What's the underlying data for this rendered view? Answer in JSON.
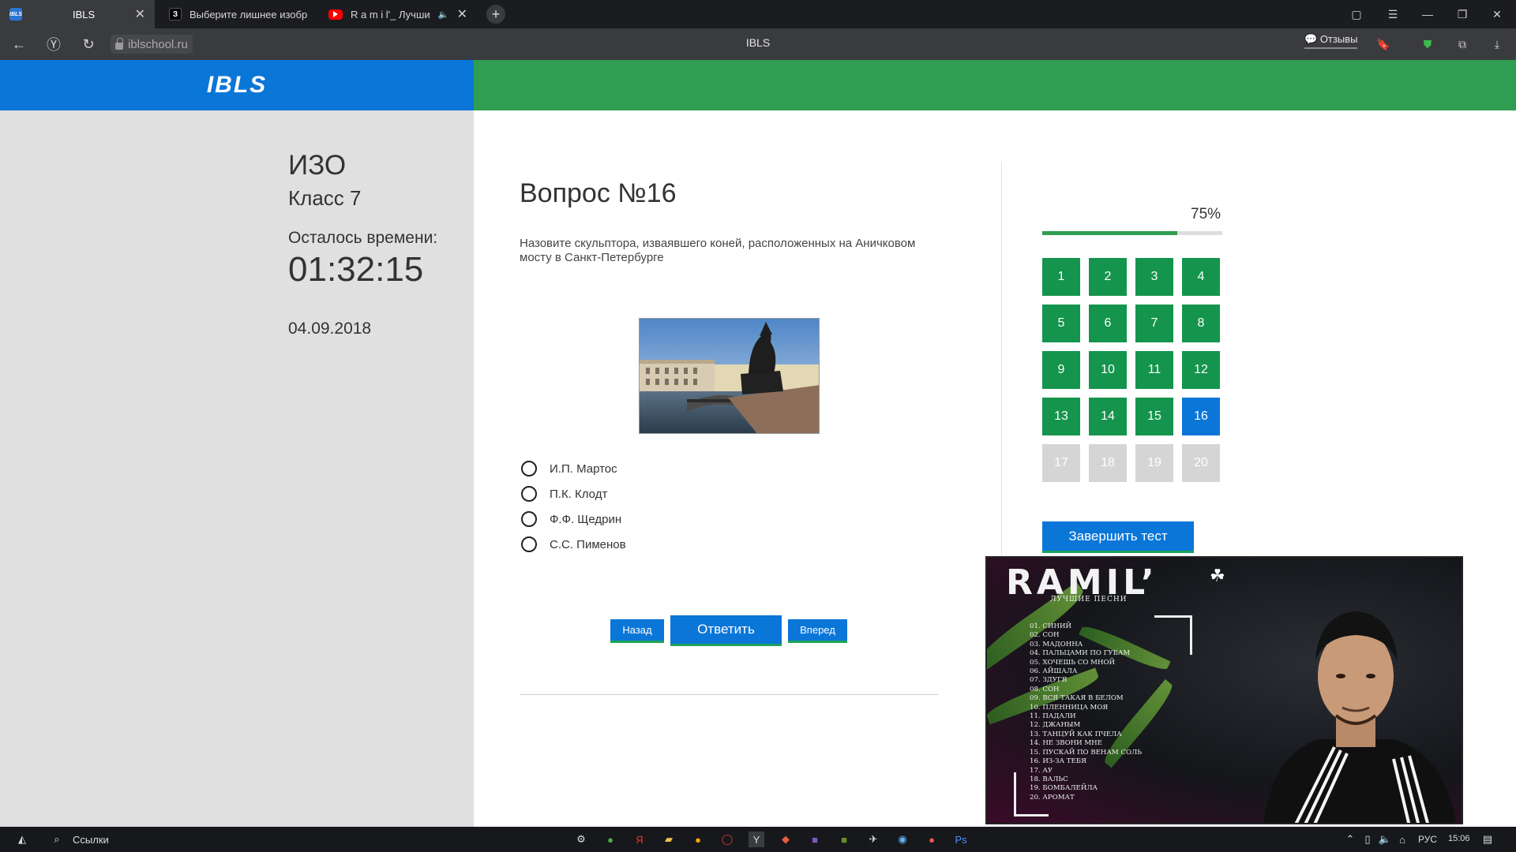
{
  "browser": {
    "tabs": [
      {
        "title": "IBLS",
        "favicon": "ibls-favicon",
        "active": true
      },
      {
        "title": "Выберите лишнее изобр",
        "favicon": "zen-favicon",
        "active": false
      },
      {
        "title": "R a m i l'_ Лучшие г",
        "favicon": "youtube-favicon",
        "active": false
      }
    ],
    "url": "iblschool.ru",
    "page_title": "IBLS",
    "feedback_label": "Отзывы"
  },
  "header": {
    "logo": "IBLS",
    "brand_colors": {
      "blue": "#0a76d8",
      "green": "#2f9d52"
    }
  },
  "sidebar": {
    "subject": "ИЗО",
    "class": "Класс 7",
    "time_remaining_label": "Осталось времени:",
    "timer": "01:32:15",
    "date": "04.09.2018"
  },
  "question": {
    "title": "Вопрос №16",
    "text": "Назовите скульптора, изваявшего коней, расположенных на Аничковом мосту в Санкт-Петербурге",
    "options": [
      "И.П. Мартос",
      "П.К. Клодт",
      "Ф.Ф. Щедрин",
      "С.С. Пименов"
    ]
  },
  "nav_buttons": {
    "back": "Назад",
    "answer": "Ответить",
    "forward": "Вперед"
  },
  "progress": {
    "label": "75%",
    "percent": 75
  },
  "question_grid": {
    "numbers": [
      "1",
      "2",
      "3",
      "4",
      "5",
      "6",
      "7",
      "8",
      "9",
      "10",
      "11",
      "12",
      "13",
      "14",
      "15",
      "16",
      "17",
      "18",
      "19",
      "20"
    ],
    "completed_through": 15,
    "current": 16
  },
  "finish_button": "Завершить тест",
  "video": {
    "title": "RAMIL’",
    "subtitle": "ЛУЧШИЕ ПЕСНИ",
    "tracks": [
      "01. СИНИЙ",
      "02. СОН",
      "03. МАДОННА",
      "04. ПАЛЬЦАМИ ПО ГУБАМ",
      "05. ХОЧЕШЬ СО МНОЙ",
      "06. АЙШАЛА",
      "07. ЗДУГЯ",
      "08. СОН",
      "09. ВСЯ ТАКАЯ В БЕЛОМ",
      "10. ПЛЕННИЦА МОЯ",
      "11. ПАДАЛИ",
      "12. ДЖАНЫМ",
      "13. ТАНЦУЙ КАК ПЧЕЛА",
      "14. НЕ ЗВОНИ МНЕ",
      "15. ПУСКАЙ ПО ВЕНАМ СОЛЬ",
      "16. ИЗ-ЗА ТЕБЯ",
      "17. АУ",
      "18. ВАЛЬС",
      "19. БОМБАЛЕЙЛА",
      "20. АРОМАТ"
    ]
  },
  "taskbar": {
    "links_label": "Ссылки",
    "language": "РУС",
    "time": "15:06"
  }
}
